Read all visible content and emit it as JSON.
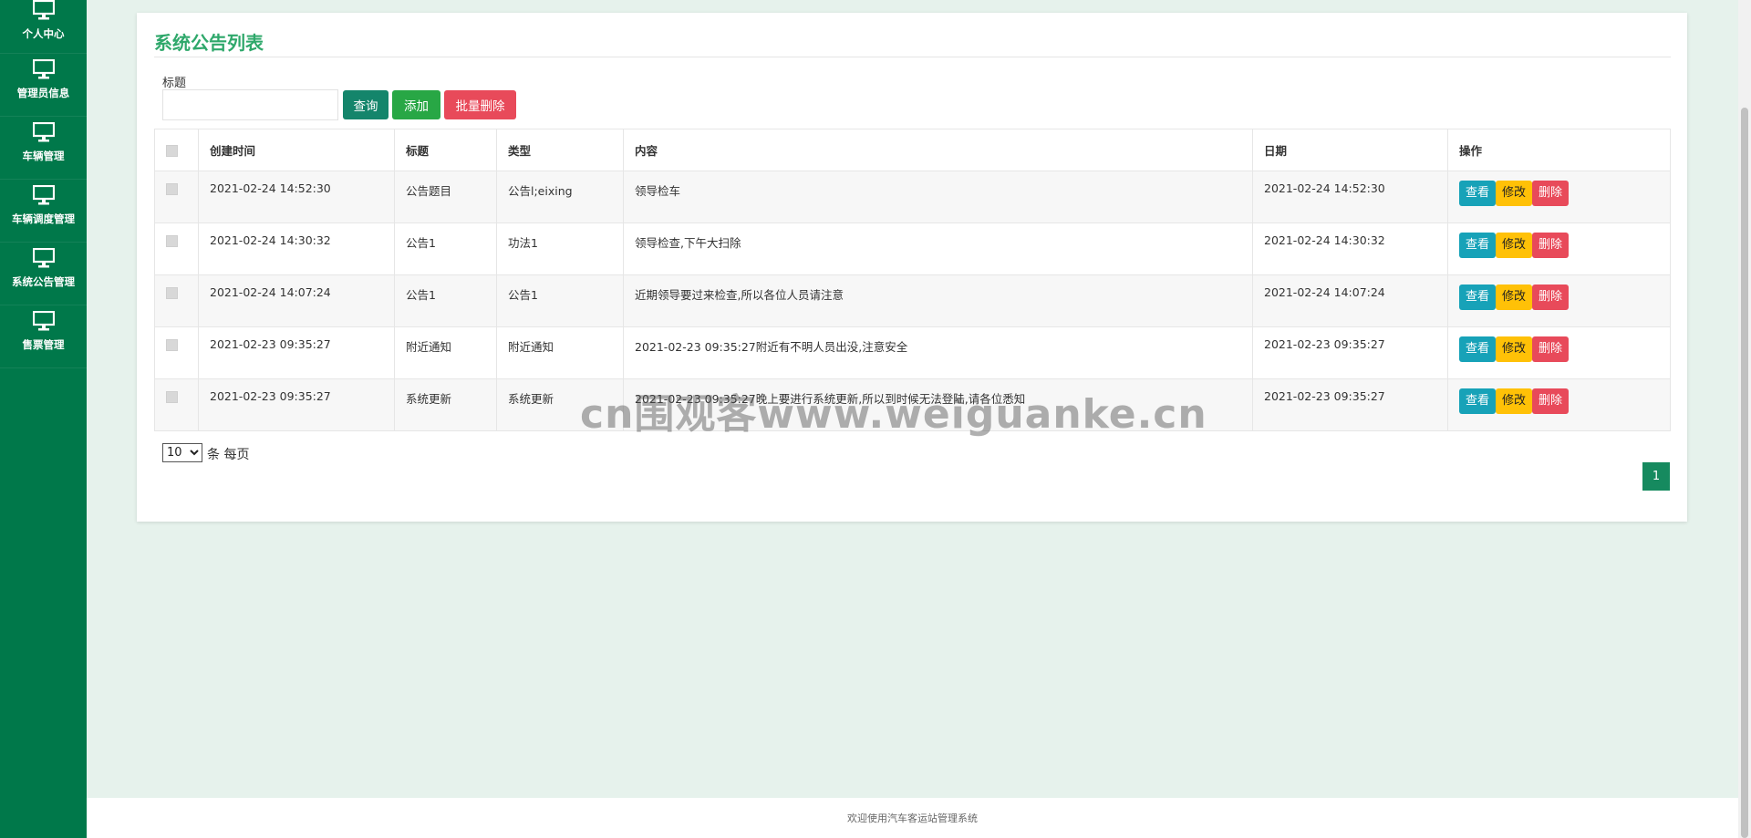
{
  "sidebar": {
    "items": [
      {
        "label": "个人中心",
        "icon": "monitor-icon"
      },
      {
        "label": "管理员信息",
        "icon": "monitor-icon"
      },
      {
        "label": "车辆管理",
        "icon": "monitor-icon"
      },
      {
        "label": "车辆调度管理",
        "icon": "monitor-icon"
      },
      {
        "label": "系统公告管理",
        "icon": "monitor-icon"
      },
      {
        "label": "售票管理",
        "icon": "monitor-icon"
      }
    ]
  },
  "panel": {
    "title": "系统公告列表",
    "search_label": "标题",
    "search_value": "",
    "query_label": "查询",
    "add_label": "添加",
    "batch_delete_label": "批量删除"
  },
  "table": {
    "columns": [
      "创建时间",
      "标题",
      "类型",
      "内容",
      "日期",
      "操作"
    ],
    "action_labels": {
      "view": "查看",
      "edit": "修改",
      "delete": "删除"
    },
    "rows": [
      {
        "created": "2021-02-24 14:52:30",
        "title": "公告题目",
        "type": "公告l;eixing",
        "content": "领导检车",
        "date": "2021-02-24 14:52:30"
      },
      {
        "created": "2021-02-24 14:30:32",
        "title": "公告1",
        "type": "功法1",
        "content": "领导检查,下午大扫除",
        "date": "2021-02-24 14:30:32"
      },
      {
        "created": "2021-02-24 14:07:24",
        "title": "公告1",
        "type": "公告1",
        "content": "近期领导要过来检查,所以各位人员请注意",
        "date": "2021-02-24 14:07:24"
      },
      {
        "created": "2021-02-23 09:35:27",
        "title": "附近通知",
        "type": "附近通知",
        "content": "2021-02-23 09:35:27附近有不明人员出没,注意安全",
        "date": "2021-02-23 09:35:27"
      },
      {
        "created": "2021-02-23 09:35:27",
        "title": "系统更新",
        "type": "系统更新",
        "content": "2021-02-23 09:35:27晚上要进行系统更新,所以到时候无法登陆,请各位悉知",
        "date": "2021-02-23 09:35:27"
      }
    ]
  },
  "pagination": {
    "page_size": "10",
    "page_size_suffix": "条 每页",
    "current_page": "1"
  },
  "footer": {
    "text": "欢迎使用汽车客运站管理系统"
  },
  "watermark": {
    "text": "cn围观客www.weiguanke.cn"
  },
  "colors": {
    "sidebar": "#00784a",
    "accent": "#2fa86b",
    "query": "#14856b",
    "add": "#28a745",
    "danger": "#e84a5a",
    "view": "#17a2b8",
    "edit": "#ffc107"
  }
}
